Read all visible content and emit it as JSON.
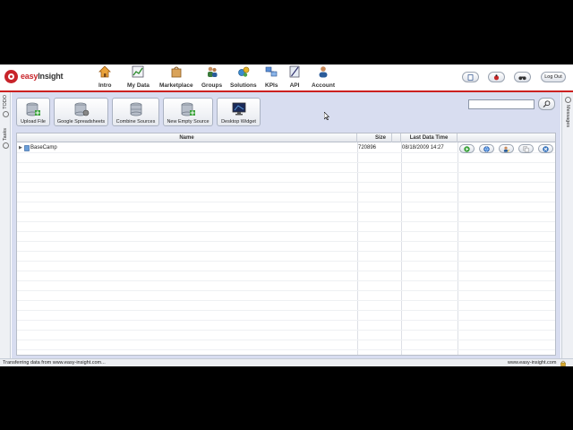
{
  "logo": {
    "brand_easy": "easy",
    "brand_insight": "Insight"
  },
  "nav": [
    {
      "label": "Intro",
      "icon": "house-icon"
    },
    {
      "label": "My Data",
      "icon": "chart-icon"
    },
    {
      "label": "Marketplace",
      "icon": "bag-icon"
    },
    {
      "label": "Groups",
      "icon": "people-icon"
    },
    {
      "label": "Solutions",
      "icon": "gears-icon"
    },
    {
      "label": "KPIs",
      "icon": "kpi-icon"
    },
    {
      "label": "API",
      "icon": "api-icon"
    },
    {
      "label": "Account",
      "icon": "user-icon"
    }
  ],
  "header_buttons": {
    "logout_label": "Log Out"
  },
  "side_tabs": {
    "todo": "TODO",
    "tasks": "Tasks",
    "messages": "Messages"
  },
  "toolbar": {
    "upload": "Upload File",
    "google": "Google Spreadsheets",
    "combine": "Combine Sources",
    "new_empty": "New Empty Source",
    "widget": "Desktop Widget"
  },
  "search": {
    "value": ""
  },
  "grid": {
    "columns": [
      "Name",
      "Size",
      "Last Data Time"
    ],
    "rows": [
      {
        "name": "BaseCamp",
        "size": "720896",
        "last_time": "08/18/2009 14:27"
      }
    ]
  },
  "status": {
    "left": "Transferring data from www.easy-insight.com...",
    "right": "www.easy-insight.com"
  },
  "colors": {
    "accent": "#cc2020",
    "content_bg": "#d8ddf0"
  }
}
